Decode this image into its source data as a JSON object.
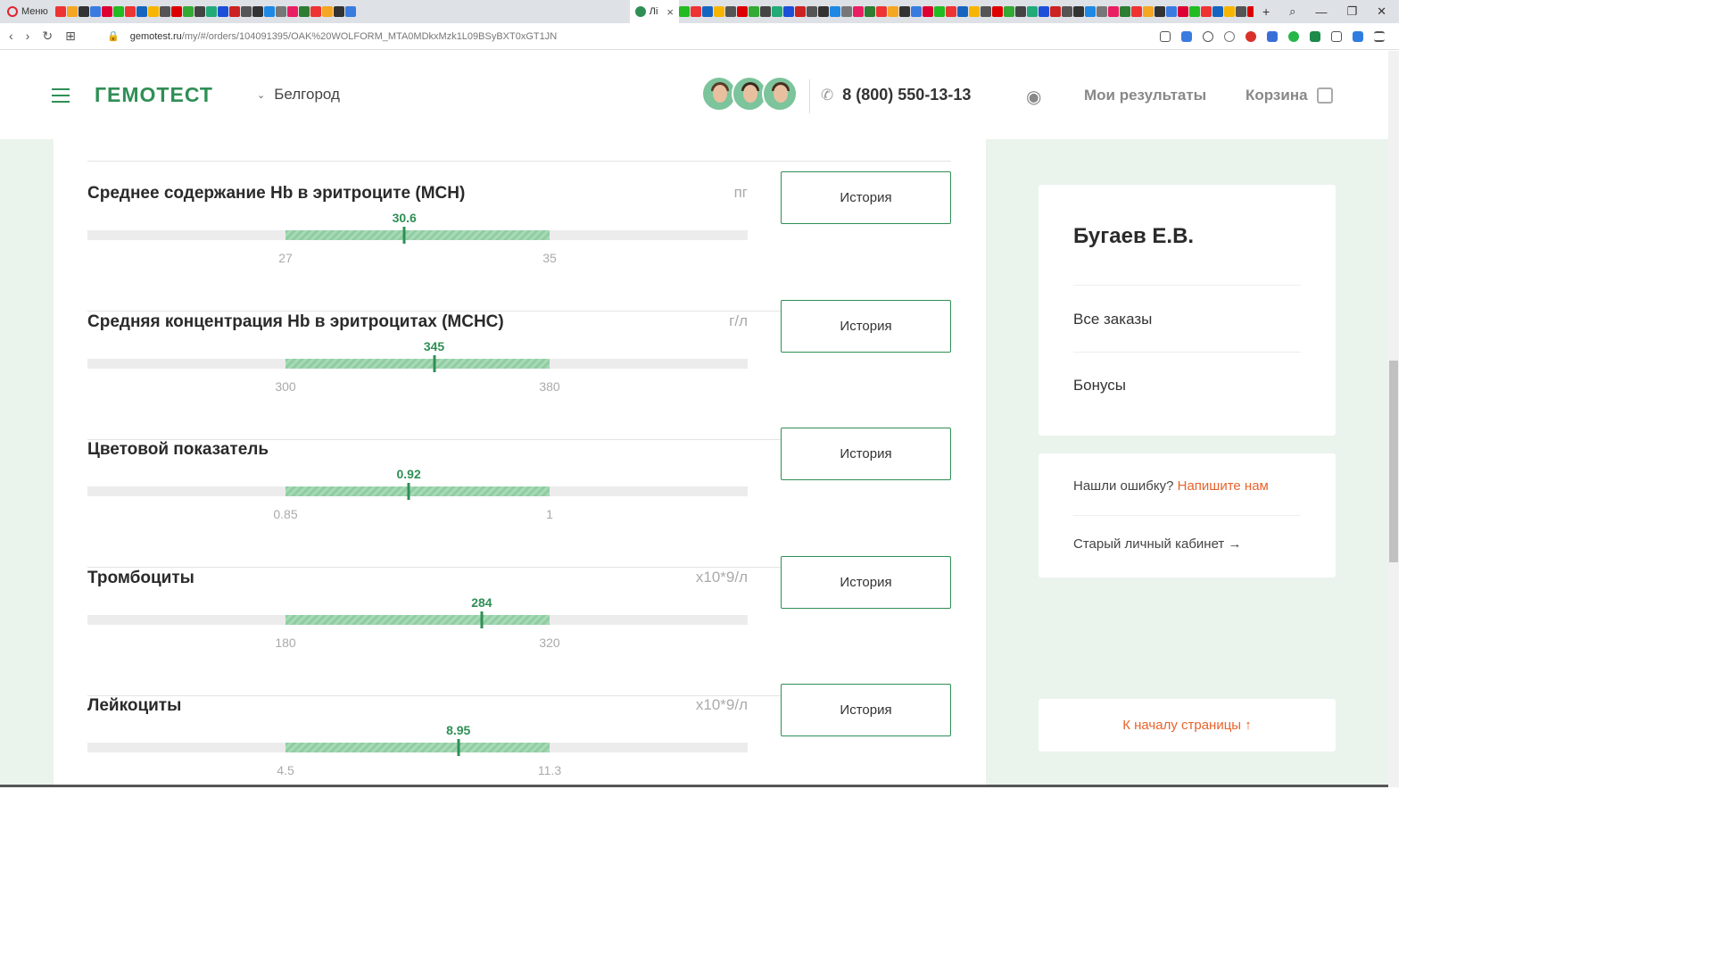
{
  "browser": {
    "menu_label": "Меню",
    "active_tab_label": "Лі",
    "tab_close": "×",
    "new_tab": "+",
    "url_host": "gemotest.ru",
    "url_path": "/my/#/orders/104091395/OAK%20WOLFORM_MTA0MDkxMzk1L09BSyBXT0xGT1JN",
    "win_controls": [
      "⌕",
      "—",
      "❐",
      "✕"
    ],
    "nav": [
      "‹",
      "›",
      "↻",
      "⊞"
    ]
  },
  "header": {
    "logo": "ГЕМОТЕСТ",
    "city": "Белгород",
    "city_chevron": "⌄",
    "phone": "8 (800) 550-13-13",
    "results": "Мои результаты",
    "cart": "Корзина",
    "icons": [
      "menu-icon",
      "chevron-down-icon",
      "phone-icon",
      "eye-plus-icon",
      "bag-icon"
    ]
  },
  "results": [
    {
      "title": "Среднее содержание Hb в эритроците (MCH)",
      "unit": "пг",
      "value": "30.6",
      "min": "27",
      "max": "35",
      "value_num": 30.6,
      "min_num": 27,
      "max_num": 35,
      "button": "История"
    },
    {
      "title": "Средняя концентрация Hb в эритроцитах (MCHC)",
      "unit": "г/л",
      "value": "345",
      "min": "300",
      "max": "380",
      "value_num": 345,
      "min_num": 300,
      "max_num": 380,
      "button": "История"
    },
    {
      "title": "Цветовой показатель",
      "unit": "",
      "value": "0.92",
      "min": "0.85",
      "max": "1",
      "value_num": 0.92,
      "min_num": 0.85,
      "max_num": 1,
      "button": "История"
    },
    {
      "title": "Тромбоциты",
      "unit": "x10*9/л",
      "value": "284",
      "min": "180",
      "max": "320",
      "value_num": 284,
      "min_num": 180,
      "max_num": 320,
      "button": "История"
    },
    {
      "title": "Лейкоциты",
      "unit": "x10*9/л",
      "value": "8.95",
      "min": "4.5",
      "max": "11.3",
      "value_num": 8.95,
      "min_num": 4.5,
      "max_num": 11.3,
      "button": "История"
    }
  ],
  "sidebar": {
    "name": "Бугаев Е.В.",
    "all_orders": "Все заказы",
    "bonuses": "Бонусы",
    "found_error": "Нашли ошибку?",
    "write_us": "Напишите нам",
    "old_cabinet": "Старый личный кабинет →",
    "to_top": "К началу страницы ↑"
  },
  "colors": {
    "brand": "#2f8f55",
    "accent": "#e8632b",
    "range": "#a9d9b6"
  }
}
